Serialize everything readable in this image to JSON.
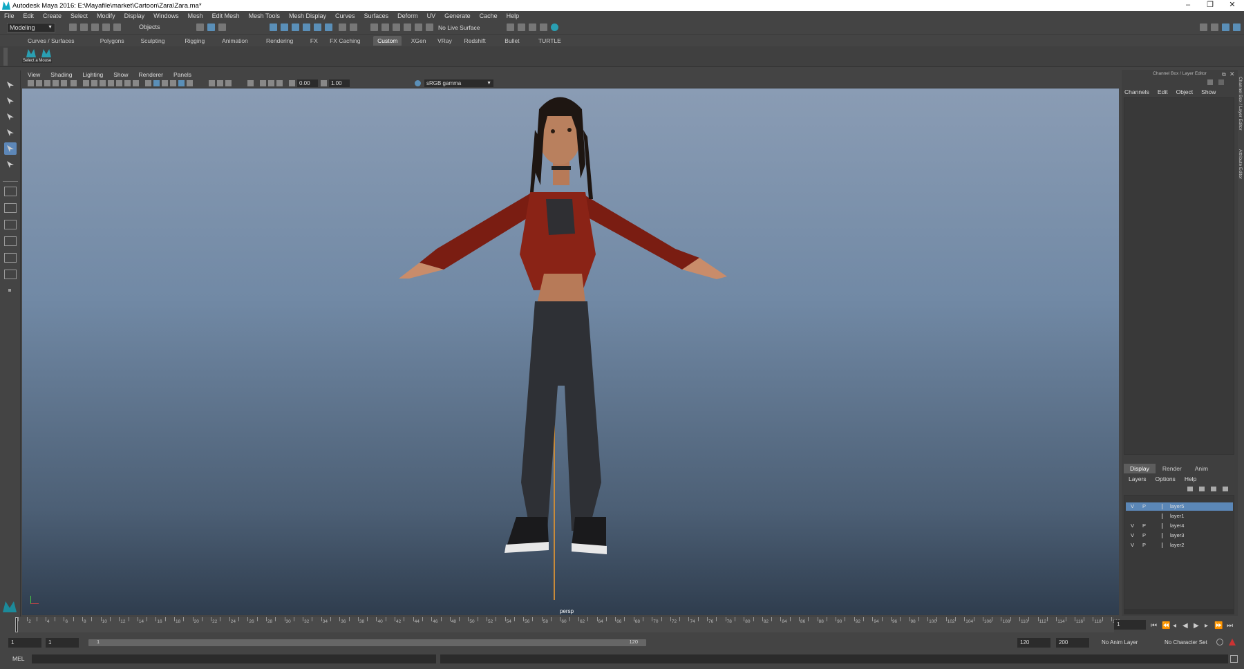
{
  "window": {
    "title": "Autodesk Maya 2016: E:\\Mayafile\\market\\Cartoon\\Zara\\Zara.ma*",
    "min": "–",
    "restore": "❐",
    "close": "✕"
  },
  "menubar": [
    "File",
    "Edit",
    "Create",
    "Select",
    "Modify",
    "Display",
    "Windows",
    "Mesh",
    "Edit Mesh",
    "Mesh Tools",
    "Mesh Display",
    "Curves",
    "Surfaces",
    "Deform",
    "UV",
    "Generate",
    "Cache",
    "Help"
  ],
  "statusline": {
    "mode": "Modeling",
    "objects_label": "Objects",
    "live_surface": "No Live Surface"
  },
  "shelf_tabs": [
    "Curves / Surfaces",
    "Polygons",
    "Sculpting",
    "Rigging",
    "Animation",
    "Rendering",
    "FX",
    "FX Caching",
    "Custom",
    "XGen",
    "VRay",
    "Redshift",
    "Bullet",
    "TURTLE"
  ],
  "shelf_active": "Custom",
  "shelf": {
    "tooltip": "Select a Mouse"
  },
  "panel_menu": [
    "View",
    "Shading",
    "Lighting",
    "Show",
    "Renderer",
    "Panels"
  ],
  "panel_toolbar": {
    "exposure": "0.00",
    "gamma_value": "1.00",
    "color_space": "sRGB gamma"
  },
  "viewport": {
    "camera": "persp"
  },
  "channel_box": {
    "header": "Channel Box / Layer Editor",
    "menu": [
      "Channels",
      "Edit",
      "Object",
      "Show"
    ]
  },
  "layer_editor": {
    "tabs": [
      "Display",
      "Render",
      "Anim"
    ],
    "active_tab": "Display",
    "menu": [
      "Layers",
      "Options",
      "Help"
    ],
    "layers": [
      {
        "v": "V",
        "p": "P",
        "name": "layer5",
        "selected": true
      },
      {
        "v": "",
        "p": "",
        "name": "layer1",
        "selected": false
      },
      {
        "v": "V",
        "p": "P",
        "name": "layer4",
        "selected": false
      },
      {
        "v": "V",
        "p": "P",
        "name": "layer3",
        "selected": false
      },
      {
        "v": "V",
        "p": "P",
        "name": "layer2",
        "selected": false
      }
    ]
  },
  "side_tabs": [
    "Channel Box / Layer Editor",
    "Attribute Editor"
  ],
  "timeline": {
    "tick_labels": [
      "2",
      "4",
      "6",
      "8",
      "10",
      "12",
      "14",
      "16",
      "18",
      "20",
      "22",
      "24",
      "26",
      "28",
      "30",
      "32",
      "34",
      "36",
      "38",
      "40",
      "42",
      "44",
      "46",
      "48",
      "50",
      "52",
      "54",
      "56",
      "58",
      "60",
      "62",
      "64",
      "66",
      "68",
      "70",
      "72",
      "74",
      "76",
      "78",
      "80",
      "82",
      "84",
      "86",
      "88",
      "90",
      "92",
      "94",
      "96",
      "98",
      "100",
      "102",
      "104",
      "106",
      "108",
      "110",
      "112",
      "114",
      "116",
      "118",
      "120"
    ],
    "current_frame": "1"
  },
  "range": {
    "start": "1",
    "start_inner": "1",
    "slider_start": "1",
    "slider_end": "120",
    "end_inner": "120",
    "end": "200",
    "anim_layer": "No Anim Layer",
    "character_set": "No Character Set"
  },
  "command_line": {
    "label": "MEL"
  }
}
